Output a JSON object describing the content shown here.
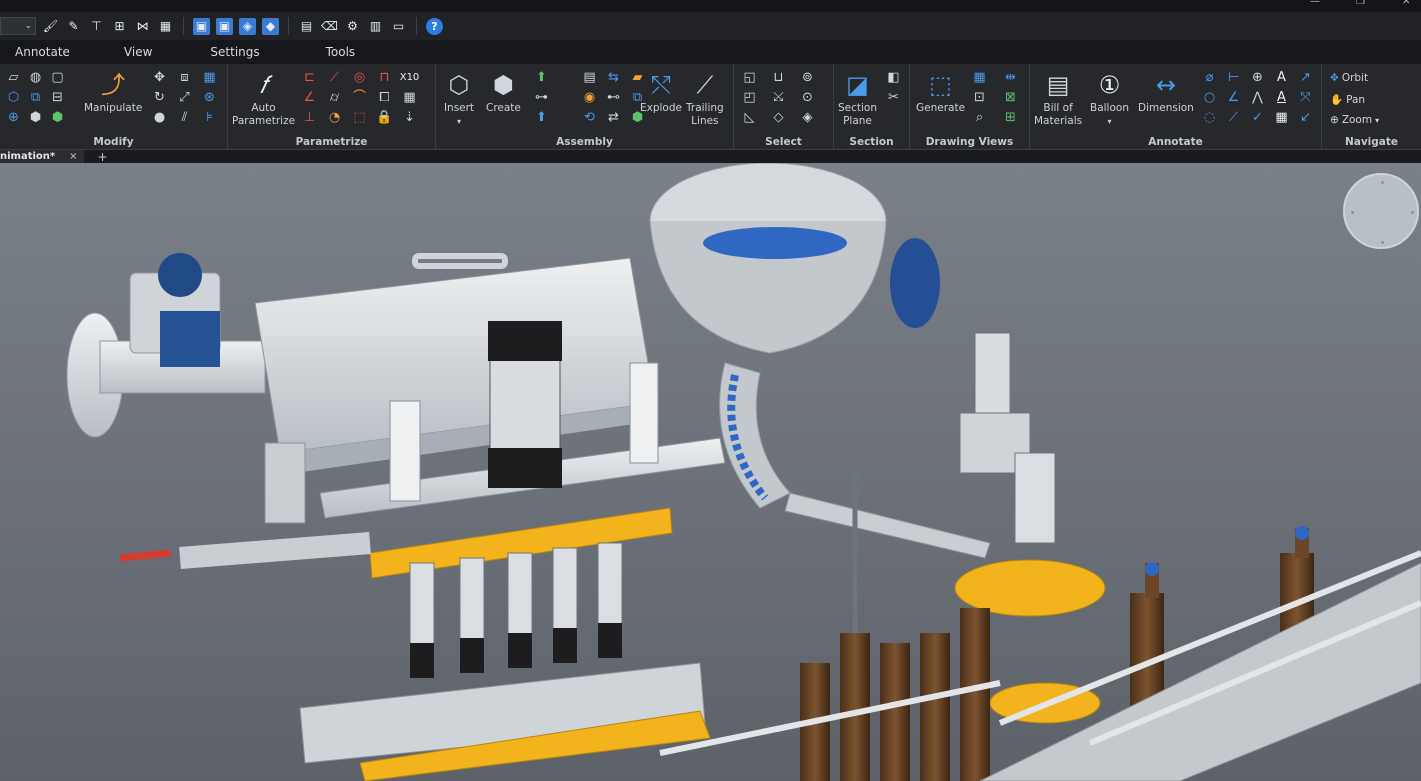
{
  "menu": {
    "tabs": [
      "Annotate",
      "View",
      "Settings",
      "Tools"
    ]
  },
  "ribbon": {
    "modify": {
      "title": "Modify",
      "manipulate_label": "Manipulate"
    },
    "parametrize": {
      "title": "Parametrize",
      "auto_parametrize_label": "Auto\nParametrize",
      "x10_label": "X10"
    },
    "assembly": {
      "title": "Assembly",
      "insert_label": "Insert",
      "create_label": "Create",
      "explode_label": "Explode",
      "trailing_lines_label": "Trailing\nLines"
    },
    "select": {
      "title": "Select"
    },
    "section": {
      "title": "Section",
      "section_plane_label": "Section\nPlane"
    },
    "drawing_views": {
      "title": "Drawing Views",
      "generate_label": "Generate"
    },
    "annotate": {
      "title": "Annotate",
      "bill_of_materials_label": "Bill of\nMaterials",
      "balloon_label": "Balloon",
      "dimension_label": "Dimension",
      "text_glyph": "A",
      "tol_glyph": "A"
    },
    "navigate": {
      "title": "Navigate",
      "orbit_label": "Orbit",
      "pan_label": "Pan",
      "zoom_label": "Zoom"
    }
  },
  "document": {
    "tab_label": "nimation*",
    "close_glyph": "×",
    "add_glyph": "+"
  },
  "colors": {
    "accent_blue": "#3a7bd5",
    "machine_yellow": "#f2b31c",
    "bottle_brown": "#6b4526",
    "steel": "#d9dde1",
    "viewport_bg": "#6b7078"
  },
  "icons": {
    "help": "help-icon",
    "orbit": "orbit-icon",
    "pan": "pan-icon",
    "zoom": "zoom-icon"
  }
}
